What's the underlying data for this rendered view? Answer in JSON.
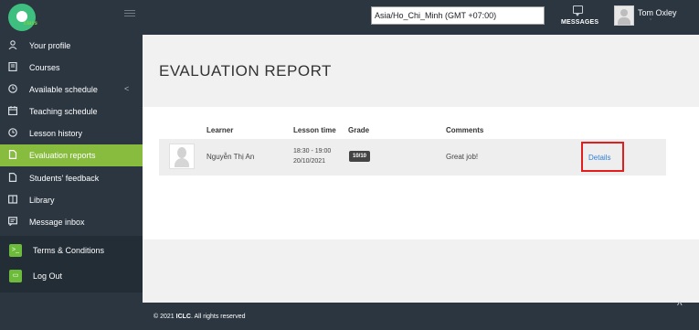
{
  "header": {
    "logo_text": "class",
    "timezone": "Asia/Ho_Chi_Minh (GMT +07:00)",
    "messages_label": "MESSAGES",
    "user_name": "Tom Oxley",
    "user_chevron": "ˇ"
  },
  "sidebar": {
    "items": [
      {
        "label": "Your profile",
        "icon": "user-icon"
      },
      {
        "label": "Courses",
        "icon": "book-icon"
      },
      {
        "label": "Available schedule",
        "icon": "clock-icon",
        "chevron": "<"
      },
      {
        "label": "Teaching schedule",
        "icon": "calendar-icon"
      },
      {
        "label": "Lesson history",
        "icon": "clock-icon"
      },
      {
        "label": "Evaluation reports",
        "icon": "file-icon",
        "active": true
      },
      {
        "label": "Students' feedback",
        "icon": "file-icon"
      },
      {
        "label": "Library",
        "icon": "library-icon"
      },
      {
        "label": "Message inbox",
        "icon": "inbox-icon"
      }
    ],
    "bottom": [
      {
        "label": "Terms & Conditions",
        "icon": "terminal-icon"
      },
      {
        "label": "Log Out",
        "icon": "folder-icon"
      }
    ]
  },
  "main": {
    "title": "EVALUATION REPORT",
    "columns": {
      "learner": "Learner",
      "lesson_time": "Lesson time",
      "grade": "Grade",
      "comments": "Comments"
    },
    "rows": [
      {
        "learner": "Nguyễn Thị An",
        "time": "18:30 - 19:00",
        "date": "20/10/2021",
        "grade": "10/10",
        "comment": "Great job!",
        "details": "Details"
      }
    ]
  },
  "footer": {
    "copyright_prefix": "© 2021 ",
    "brand": "ICLC",
    "copyright_suffix": ". All rights reserved",
    "scroll_top": "^"
  },
  "colors": {
    "sidebar_bg": "#2b3641",
    "active": "#88bc3f",
    "link": "#2f7fd6",
    "highlight": "#e11d1d"
  }
}
